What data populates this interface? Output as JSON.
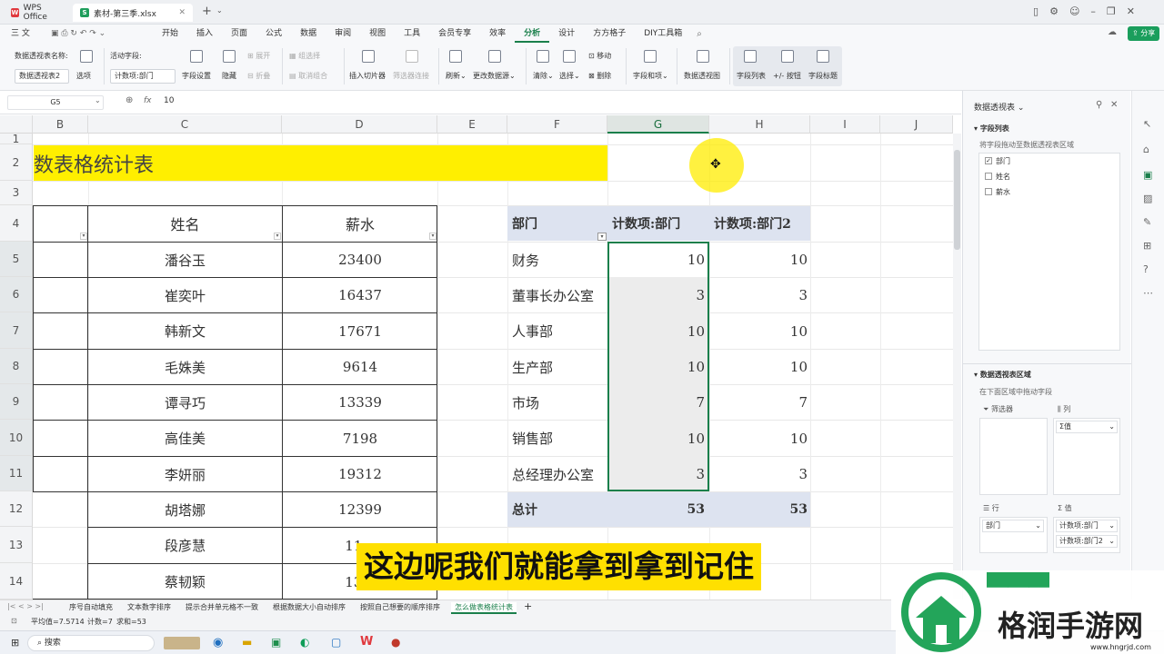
{
  "titlebar": {
    "tabs": [
      {
        "label": "WPS Office"
      },
      {
        "label": "素材-第三季.xlsx"
      }
    ]
  },
  "menu": {
    "items": [
      "三 文件",
      "开始",
      "插入",
      "页面",
      "公式",
      "数据",
      "审阅",
      "视图",
      "工具",
      "会员专享",
      "效率",
      "分析",
      "设计",
      "方方格子",
      "DIY工具箱"
    ],
    "share": "分享"
  },
  "ribbon": {
    "pivot_name_label": "数据透视表名称:",
    "pivot_name_value": "数据透视表2",
    "options_label": "选项",
    "active_field_label": "活动字段:",
    "active_field_value": "计数项:部门",
    "field_settings": "字段设置",
    "hide": "隐藏",
    "expand": "展开",
    "collapse": "折叠",
    "group_selection": "组选择",
    "ungroup": "取消组合",
    "insert_slicer": "插入切片器",
    "filter_connections": "筛选器连接",
    "refresh": "刷新",
    "change_source": "更改数据源",
    "clear": "清除",
    "select": "选择",
    "move": "移动",
    "delete": "删除",
    "fields_items": "字段和项",
    "pivot_view": "数据透视图",
    "field_list": "字段列表",
    "plus_minus": "+/- 按钮",
    "field_headers": "字段标题"
  },
  "formula": {
    "cell_ref": "G5",
    "fx": "fx",
    "value": "10"
  },
  "columns": [
    "B",
    "C",
    "D",
    "E",
    "F",
    "G",
    "H",
    "I",
    "J"
  ],
  "rows": [
    "1",
    "2",
    "3",
    "4",
    "5",
    "6",
    "7",
    "8",
    "9",
    "10",
    "11",
    "12",
    "13",
    "14"
  ],
  "sheet": {
    "title": "数表格统计表",
    "header_name": "姓名",
    "header_salary": "薪水",
    "people": [
      {
        "name": "潘谷玉",
        "salary": "23400"
      },
      {
        "name": "崔奕叶",
        "salary": "16437"
      },
      {
        "name": "韩新文",
        "salary": "17671"
      },
      {
        "name": "毛姝美",
        "salary": "9614"
      },
      {
        "name": "谭寻巧",
        "salary": "13339"
      },
      {
        "name": "高佳美",
        "salary": "7198"
      },
      {
        "name": "李妍丽",
        "salary": "19312"
      },
      {
        "name": "胡塔娜",
        "salary": "12399"
      },
      {
        "name": "段彦慧",
        "salary": "11..."
      },
      {
        "name": "蔡韧颖",
        "salary": "13..."
      }
    ]
  },
  "pivot": {
    "h_dept": "部门",
    "h_count1": "计数项:部门",
    "h_count2": "计数项:部门2",
    "rows": [
      {
        "dept": "财务",
        "c1": "10",
        "c2": "10"
      },
      {
        "dept": "董事长办公室",
        "c1": "3",
        "c2": "3"
      },
      {
        "dept": "人事部",
        "c1": "10",
        "c2": "10"
      },
      {
        "dept": "生产部",
        "c1": "10",
        "c2": "10"
      },
      {
        "dept": "市场",
        "c1": "7",
        "c2": "7"
      },
      {
        "dept": "销售部",
        "c1": "10",
        "c2": "10"
      },
      {
        "dept": "总经理办公室",
        "c1": "3",
        "c2": "3"
      }
    ],
    "total_label": "总计",
    "total_c1": "53",
    "total_c2": "53"
  },
  "subtitle": "这边呢我们就能拿到拿到记住",
  "panel": {
    "title": "数据透视表",
    "field_list": "字段列表",
    "drag_hint": "将字段拖动至数据透视表区域",
    "fields": [
      {
        "label": "部门",
        "checked": true
      },
      {
        "label": "姓名",
        "checked": false
      },
      {
        "label": "薪水",
        "checked": false
      }
    ],
    "area_title": "数据透视表区域",
    "area_hint": "在下面区域中拖动字段",
    "filter_label": "筛选器",
    "col_label": "列",
    "col_value": "Σ值",
    "row_label": "行",
    "val_label": "值",
    "row_value": "部门",
    "val_values": [
      "计数项:部门",
      "计数项:部门2"
    ]
  },
  "sheets": [
    "序号自动填充",
    "文本数字排序",
    "提示合并单元格不一致",
    "根据数据大小自动排序",
    "按照自己想要的顺序排序",
    "怎么做表格统计表"
  ],
  "status": {
    "avg": "平均值=7.5714",
    "count": "计数=7",
    "sum": "求和=53"
  },
  "taskbar": {
    "search": "搜索"
  },
  "watermark": {
    "site": "格润手游网",
    "url": "www.hngrjd.com"
  },
  "colors": {
    "accent": "#1a7f4b",
    "title_fill": "#ffef00",
    "pivot_header": "#dde3f0",
    "subtitle_bg": "#ffe000"
  }
}
